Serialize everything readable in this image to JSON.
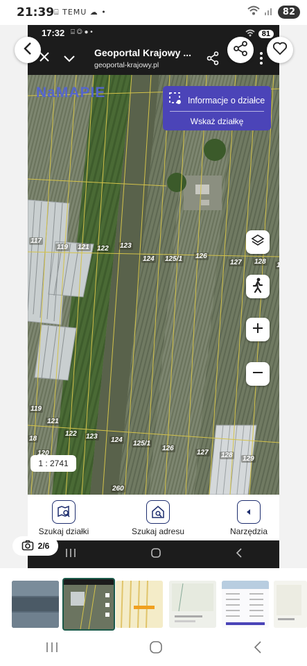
{
  "outer_status": {
    "time": "21:39",
    "small_icons": "⌸ TEMU ☁ •",
    "battery": "82"
  },
  "inner_status": {
    "time": "17:32",
    "icons": "⌸ ◎ ● •",
    "battery": "81"
  },
  "browser": {
    "title": "Geoportal Krajowy ...",
    "url": "geoportal-krajowy.pl"
  },
  "map": {
    "logo": "NaMAPIE",
    "info_panel": {
      "title": "Informacje o działce",
      "button": "Wskaż działkę"
    },
    "scale": "1 : 2741",
    "plot_labels": [
      "117",
      "119",
      "121",
      "122",
      "123",
      "124",
      "125/1",
      "126",
      "127",
      "128",
      "1",
      "119",
      "121",
      "122",
      "123",
      "124",
      "125/1",
      "126",
      "127",
      "128",
      "129",
      "18",
      "120",
      "260"
    ]
  },
  "bottom_tools": [
    {
      "label": "Szukaj działki",
      "icon": "map-search-icon"
    },
    {
      "label": "Szukaj adresu",
      "icon": "home-search-icon"
    },
    {
      "label": "Narzędzia",
      "icon": "arrow-left-icon"
    }
  ],
  "viewer": {
    "counter": "2/6"
  }
}
